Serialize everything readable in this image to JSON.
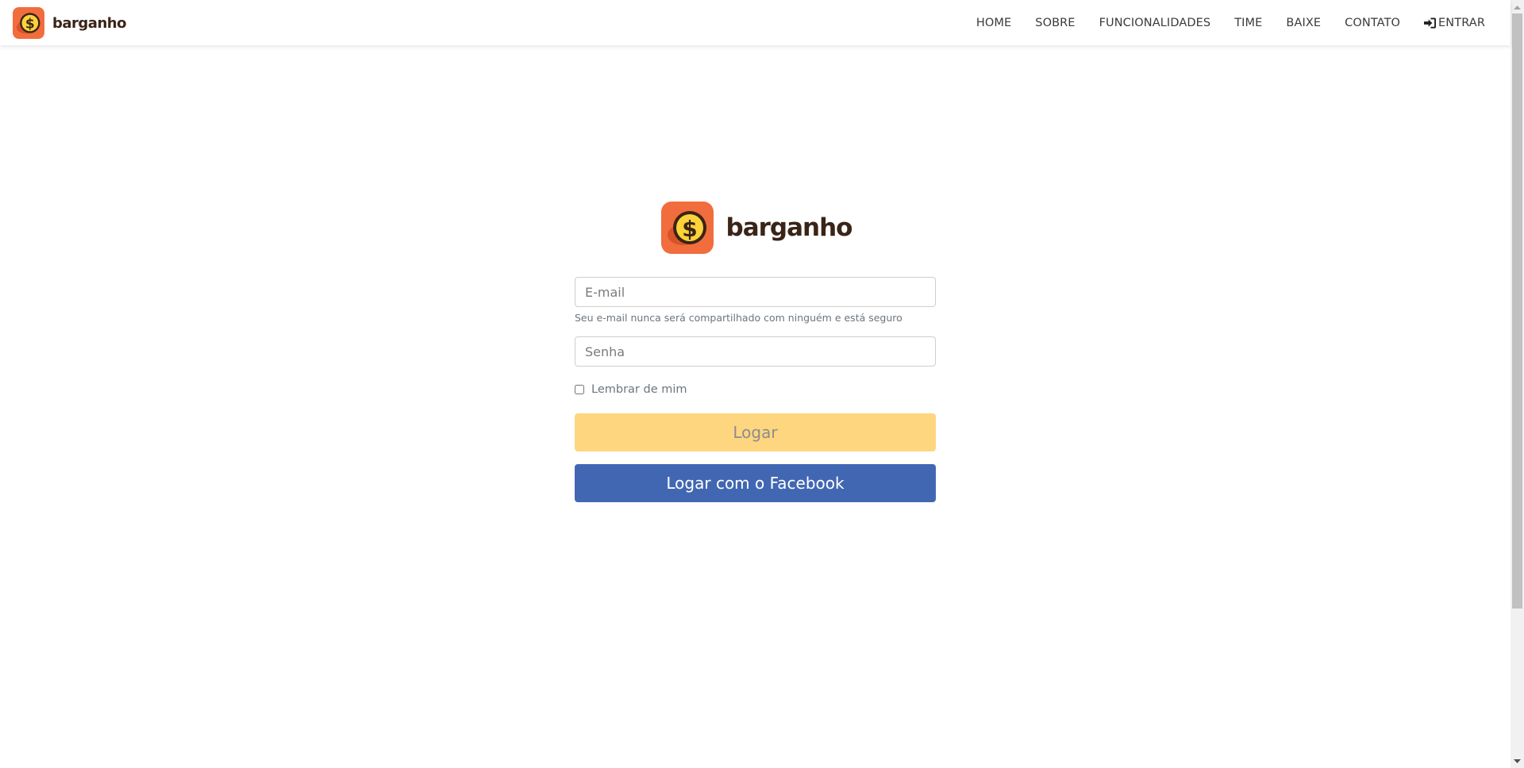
{
  "brand": {
    "name": "barganho"
  },
  "nav": {
    "items": [
      {
        "label": "HOME"
      },
      {
        "label": "SOBRE"
      },
      {
        "label": "FUNCIONALIDADES"
      },
      {
        "label": "TIME"
      },
      {
        "label": "BAIXE"
      },
      {
        "label": "CONTATO"
      },
      {
        "label": "ENTRAR",
        "icon": "sign-in-icon"
      }
    ]
  },
  "login": {
    "brand_name": "barganho",
    "email_placeholder": "E-mail",
    "email_help": "Seu e-mail nunca será compartilhado com ninguém e está seguro",
    "password_placeholder": "Senha",
    "remember_label": "Lembrar de mim",
    "submit_label": "Logar",
    "facebook_label": "Logar com o Facebook"
  },
  "colors": {
    "brand_orange": "#f26d3d",
    "coin_yellow": "#fdd23a",
    "brand_text": "#3a2417",
    "login_button": "#fed67f",
    "facebook_button": "#4267b2"
  }
}
